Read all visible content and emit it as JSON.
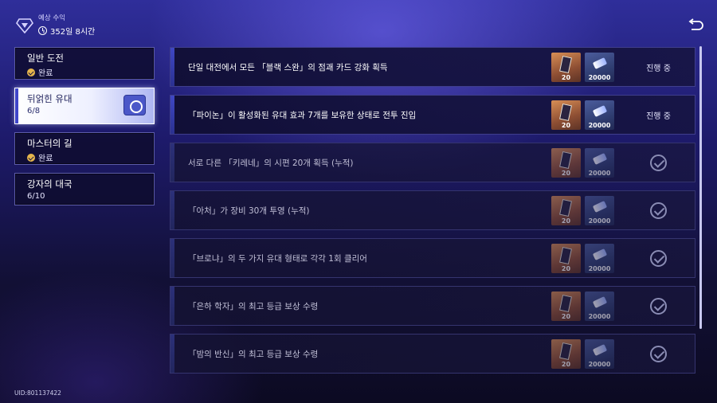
{
  "header": {
    "label": "예상 수익",
    "time": "352일 8시간",
    "gem_icon": "diamond-icon",
    "clock_icon": "clock-icon"
  },
  "back_icon": "back-arrow-icon",
  "sidebar": {
    "items": [
      {
        "title": "일반 도전",
        "sub": "완료",
        "completed": true,
        "active": false
      },
      {
        "title": "뒤얽힌 유대",
        "sub": "6/8",
        "completed": false,
        "active": true
      },
      {
        "title": "마스터의 길",
        "sub": "완료",
        "completed": true,
        "active": false
      },
      {
        "title": "강자의 대국",
        "sub": "6/10",
        "completed": false,
        "active": false
      }
    ]
  },
  "missions": [
    {
      "desc": "단일 대전에서 모든 「블랙 스완」의 점괘 카드 강화 획득",
      "reward1": "20",
      "reward2": "20000",
      "status": "진행 중",
      "done": false
    },
    {
      "desc": "「파이논」이 활성화된 유대 효과 7개를 보유한 상태로 전투 진입",
      "reward1": "20",
      "reward2": "20000",
      "status": "진행 중",
      "done": false
    },
    {
      "desc": "서로 다른 「키레네」의 시편 20개 획득 (누적)",
      "reward1": "20",
      "reward2": "20000",
      "status": "",
      "done": true
    },
    {
      "desc": "「아처」가 장비 30개 투영 (누적)",
      "reward1": "20",
      "reward2": "20000",
      "status": "",
      "done": true
    },
    {
      "desc": "「브로냐」의 두 가지 유대 형태로 각각 1회 클리어",
      "reward1": "20",
      "reward2": "20000",
      "status": "",
      "done": true
    },
    {
      "desc": "「은하 학자」의 최고 등급 보상 수령",
      "reward1": "20",
      "reward2": "20000",
      "status": "",
      "done": true
    },
    {
      "desc": "「밤의 반신」의 최고 등급 보상 수령",
      "reward1": "20",
      "reward2": "20000",
      "status": "",
      "done": true
    }
  ],
  "uid": "UID:801137422"
}
